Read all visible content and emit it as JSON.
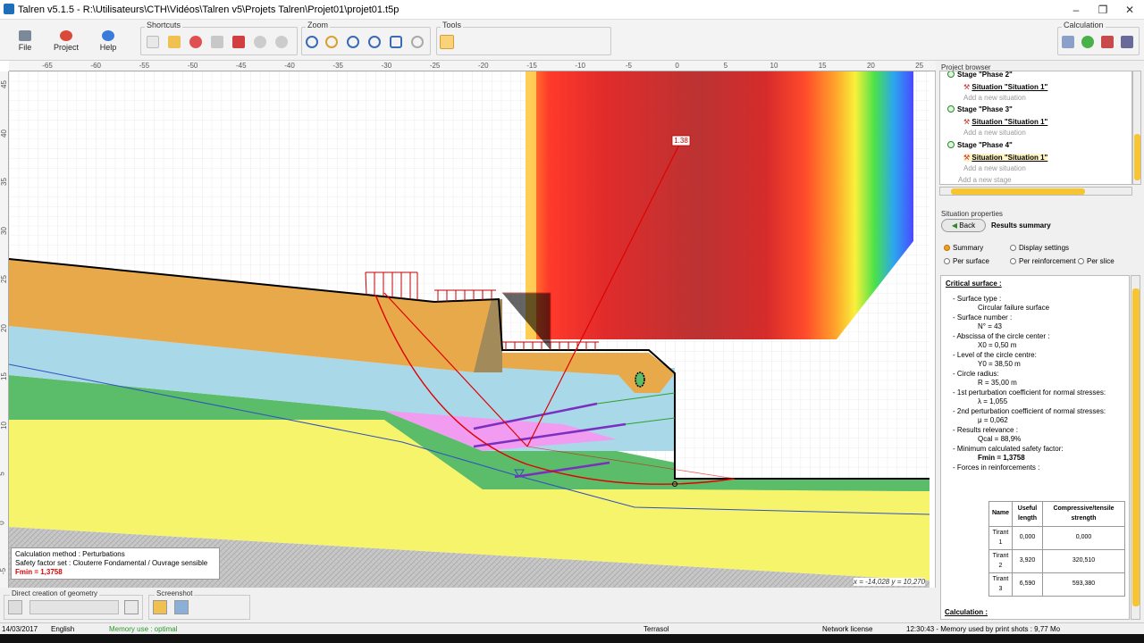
{
  "window": {
    "title": "Talren v5.1.5 - R:\\Utilisateurs\\CTH\\Vidéos\\Talren v5\\Projets Talren\\Projet01\\projet01.t5p",
    "minimize": "–",
    "maximize": "❐",
    "close": "✕"
  },
  "ribbon": {
    "file_label": "File",
    "project_label": "Project",
    "help_label": "Help",
    "shortcuts_label": "Shortcuts",
    "zoom_label": "Zoom",
    "tools_label": "Tools",
    "calculation_label": "Calculation"
  },
  "ruler": {
    "x_ticks": [
      "-65",
      "-60",
      "-55",
      "-50",
      "-45",
      "-40",
      "-35",
      "-30",
      "-25",
      "-20",
      "-15",
      "-10",
      "-5",
      "0",
      "5",
      "10",
      "15",
      "20",
      "25"
    ],
    "y_ticks": [
      "45",
      "40",
      "35",
      "30",
      "25",
      "20",
      "15",
      "10",
      "5",
      "0",
      "-5"
    ]
  },
  "drawing": {
    "circle_label": "1.38",
    "accent_red": "#e00000",
    "soil_colors": {
      "orange": "#e8a94b",
      "light_blue": "#a9d8e8",
      "green": "#5bbd69",
      "yellow": "#f6f46a",
      "pink": "#f19cf0",
      "gray": "#c8c8c8",
      "brown": "#a38a5a"
    }
  },
  "infobox": {
    "line1": "Calculation method : Perturbations",
    "line2": "Safety factor set : Clouterre Fondamental / Ouvrage sensible",
    "line3": "Fmin = 1,3758"
  },
  "coords": "x = -14,028 y = 10,270",
  "bottom_tools": {
    "direct_label": "Direct creation of geometry",
    "screenshot_label": "Screenshot"
  },
  "statusbar": {
    "date": "14/03/2017",
    "language": "English",
    "memory": "Memory use : optimal",
    "company": "Terrasol",
    "license": "Network license",
    "time_memory": "12:30:43 - Memory used by print shots : 9,77 Mo"
  },
  "project_browser": {
    "heading": "Project browser",
    "stage2": "Stage \"Phase 2\"",
    "stage3": "Stage \"Phase 3\"",
    "stage4": "Stage \"Phase 4\"",
    "situation": "Situation \"Situation 1\"",
    "add_situation": "Add a new situation",
    "add_stage": "Add a new stage"
  },
  "situation": {
    "heading": "Situation properties",
    "back": "Back",
    "results_title": "Results summary",
    "opt_summary": "Summary",
    "opt_display": "Display settings",
    "opt_surface": "Per surface",
    "opt_reinforcement": "Per reinforcement",
    "opt_slice": "Per slice"
  },
  "results": {
    "critical_heading": "Critical surface :",
    "surface_type_label": "- Surface type :",
    "surface_type_value": "Circular failure surface",
    "surface_number_label": "- Surface number :",
    "surface_number_value": "N° = 43",
    "abscissa_label": "- Abscissa of the circle center :",
    "abscissa_value": "X0 = 0,50 m",
    "level_label": "- Level of the circle centre:",
    "level_value": "Y0 = 38,50 m",
    "radius_label": "- Circle radius:",
    "radius_value": "R = 35,00 m",
    "first_coeff_label": "- 1st perturbation coefficient for normal stresses:",
    "first_coeff_value": "λ = 1,055",
    "second_coeff_label": "- 2nd perturbation coefficient of normal stresses:",
    "second_coeff_value": "μ = 0,062",
    "relevance_label": "- Results relevance :",
    "relevance_value": "Qcal = 88,9%",
    "min_sf_label": "- Minimum calculated safety factor:",
    "min_sf_value": "Fmin = 1,3758",
    "forces_label": "- Forces in reinforcements :",
    "table_headers": [
      "Name",
      "Useful length",
      "Compressive/tensile strength"
    ],
    "table_rows": [
      [
        "Tirant 1",
        "0,000",
        "0,000"
      ],
      [
        "Tirant 2",
        "3,920",
        "320,510"
      ],
      [
        "Tirant 3",
        "6,590",
        "593,380"
      ]
    ],
    "calculation_heading": "Calculation :"
  }
}
